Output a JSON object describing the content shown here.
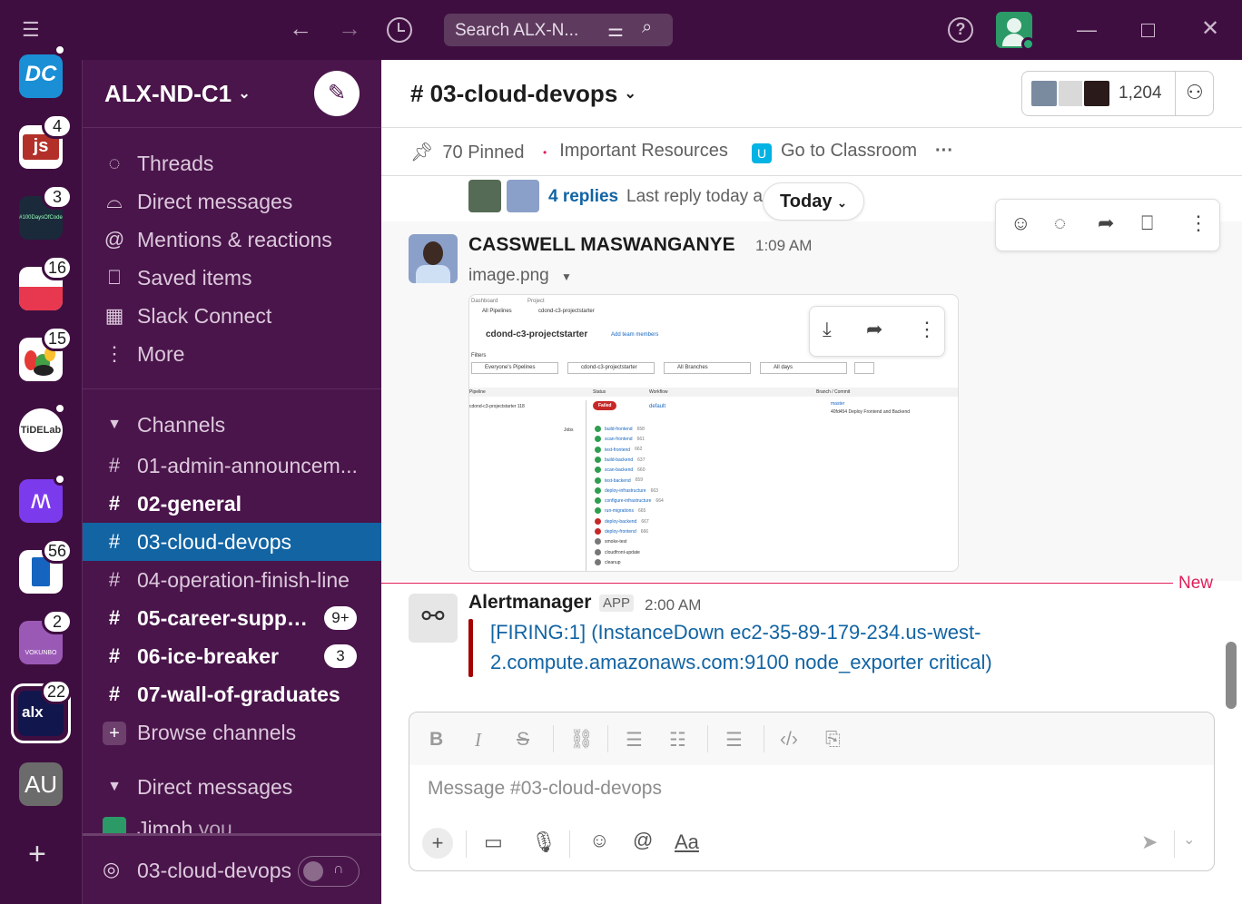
{
  "topbar": {
    "search_placeholder": "Search ALX-N..."
  },
  "rail": {
    "workspaces": [
      {
        "initials": "DC",
        "badge": "",
        "color": "#1a8fd6"
      },
      {
        "initials": "js",
        "badge": "4",
        "color": "#b3302a"
      },
      {
        "initials": "#100DaysOfCode",
        "badge": "3",
        "color": "#1a2a3a"
      },
      {
        "initials": "",
        "badge": "16",
        "color": "#e8384f"
      },
      {
        "initials": "",
        "badge": "15",
        "color": "#ffffff"
      },
      {
        "initials": "TiDELab",
        "badge": "",
        "color": "#ffffff"
      },
      {
        "initials": "",
        "badge": "",
        "color": "#7c3aed"
      },
      {
        "initials": "",
        "badge": "56",
        "color": "#ffffff"
      },
      {
        "initials": "VOKUNBO",
        "badge": "2",
        "color": "#9b59b6"
      },
      {
        "initials": "alx",
        "badge": "22",
        "color": "#11164d"
      },
      {
        "initials": "AU",
        "badge": "",
        "color": "#6b6b6b"
      }
    ]
  },
  "sidebar": {
    "workspace_name": "ALX-ND-C1",
    "nav": [
      {
        "label": "Threads",
        "icon": "threads-icon"
      },
      {
        "label": "Direct messages",
        "icon": "dm-icon"
      },
      {
        "label": "Mentions & reactions",
        "icon": "at-icon"
      },
      {
        "label": "Saved items",
        "icon": "bookmark-icon"
      },
      {
        "label": "Slack Connect",
        "icon": "building-icon"
      },
      {
        "label": "More",
        "icon": "more-icon"
      }
    ],
    "channels_header": "Channels",
    "channels": [
      {
        "name": "01-admin-announcem...",
        "bold": false,
        "badge": ""
      },
      {
        "name": "02-general",
        "bold": true,
        "badge": ""
      },
      {
        "name": "03-cloud-devops",
        "bold": false,
        "badge": "",
        "active": true
      },
      {
        "name": "04-operation-finish-line",
        "bold": false,
        "badge": ""
      },
      {
        "name": "05-career-suppor...",
        "bold": true,
        "badge": "9+"
      },
      {
        "name": "06-ice-breaker",
        "bold": true,
        "badge": "3"
      },
      {
        "name": "07-wall-of-graduates",
        "bold": true,
        "badge": ""
      }
    ],
    "browse_channels": "Browse channels",
    "dm_header": "Direct messages",
    "dm_user": "Jimoh",
    "dm_you": "you",
    "huddle_channel": "03-cloud-devops"
  },
  "channel": {
    "title": "# 03-cloud-devops",
    "member_count": "1,204",
    "bookmarks": {
      "pinned": "70 Pinned",
      "resources": "Important Resources",
      "classroom": "Go to Classroom"
    }
  },
  "thread_summary": {
    "replies": "4 replies",
    "last_reply": "Last reply today a"
  },
  "date_divider": "Today",
  "message1": {
    "author": "CASSWELL MASWANGANYE",
    "time": "1:09 AM",
    "file_name": "image.png"
  },
  "pipeline": {
    "crumb1": "Dashboard",
    "crumb2": "Project",
    "all_pipelines": "All Pipelines",
    "project": "cdond-c3-projectstarter",
    "add_members": "Add team members",
    "filters_label": "Filters",
    "filter_pipelines": "Everyone's Pipelines",
    "filter_project": "cdond-c3-projectstarter",
    "filter_branches": "All Branches",
    "filter_days": "All days",
    "col_pipeline": "Pipeline",
    "col_status": "Status",
    "col_workflow": "Workflow",
    "col_branch": "Branch / Commit",
    "row_pipeline": "cdond-c3-projectstarter 118",
    "row_status": "Failed",
    "row_workflow": "default",
    "row_branch": "master",
    "row_commit": "40fd454 Deploy Frontend and Backend",
    "jobs_label": "Jobs",
    "jobs": [
      {
        "name": "build-frontend",
        "num": "658",
        "state": "ok"
      },
      {
        "name": "scan-frontend",
        "num": "661",
        "state": "ok"
      },
      {
        "name": "test-frontend",
        "num": "662",
        "state": "ok"
      },
      {
        "name": "build-backend",
        "num": "637",
        "state": "ok"
      },
      {
        "name": "scan-backend",
        "num": "660",
        "state": "ok"
      },
      {
        "name": "test-backend",
        "num": "659",
        "state": "ok"
      },
      {
        "name": "deploy-infrastructure",
        "num": "663",
        "state": "ok"
      },
      {
        "name": "configure-infrastructure",
        "num": "664",
        "state": "ok"
      },
      {
        "name": "run-migrations",
        "num": "665",
        "state": "ok"
      },
      {
        "name": "deploy-backend",
        "num": "667",
        "state": "fail"
      },
      {
        "name": "deploy-frontend",
        "num": "666",
        "state": "fail"
      },
      {
        "name": "smoke-test",
        "num": "",
        "state": "skip"
      },
      {
        "name": "cloudfront-update",
        "num": "",
        "state": "skip"
      },
      {
        "name": "cleanup",
        "num": "",
        "state": "skip"
      }
    ]
  },
  "new_divider": "New",
  "message2": {
    "author": "Alertmanager",
    "app_tag": "APP",
    "time": "2:00 AM",
    "alert_line1": "[FIRING:1]  (InstanceDown ec2-35-89-179-234.us-west-",
    "alert_line2": "2.compute.amazonaws.com:9100 node_exporter critical)"
  },
  "composer": {
    "placeholder": "Message #03-cloud-devops",
    "format_label": "Aa"
  },
  "colors": {
    "aubergine": "#3f0e40",
    "sidebar": "#4a154b",
    "active": "#1264a3",
    "link": "#1264a3",
    "alert_bar": "#a30200",
    "new_line": "#e01e5a"
  }
}
